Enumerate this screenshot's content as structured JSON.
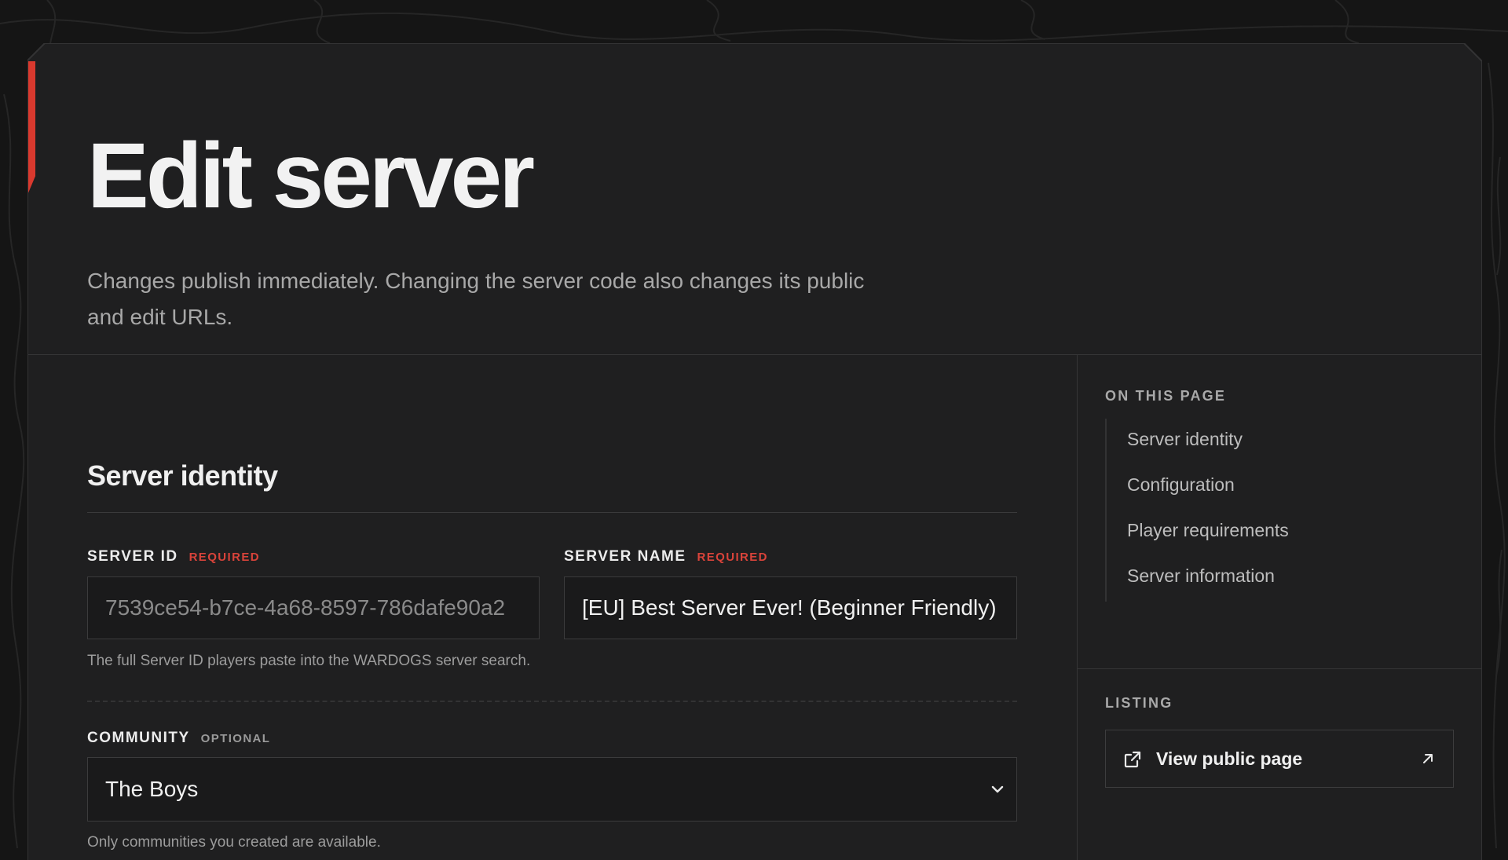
{
  "header": {
    "title": "Edit server",
    "description": "Changes publish immediately. Changing the server code also changes its public and edit URLs."
  },
  "identity": {
    "section_title": "Server identity",
    "server_id": {
      "label": "SERVER ID",
      "tag": "REQUIRED",
      "value": "7539ce54-b7ce-4a68-8597-786dafe90a2",
      "hint": "The full Server ID players paste into the WARDOGS server search."
    },
    "server_name": {
      "label": "SERVER NAME",
      "tag": "REQUIRED",
      "value": "[EU] Best Server Ever! (Beginner Friendly)"
    },
    "community": {
      "label": "COMMUNITY",
      "tag": "OPTIONAL",
      "selected": "The Boys",
      "hint": "Only communities you created are available."
    }
  },
  "sidebar": {
    "on_this_page_heading": "ON THIS PAGE",
    "toc": [
      {
        "label": "Server identity"
      },
      {
        "label": "Configuration"
      },
      {
        "label": "Player requirements"
      },
      {
        "label": "Server information"
      }
    ],
    "listing_heading": "LISTING",
    "view_public_label": "View public page"
  },
  "icons": {
    "external": "external-link-icon",
    "arrow": "arrow-up-right-icon",
    "chevron": "chevron-down-icon"
  },
  "colors": {
    "accent": "#d9392e",
    "required": "#d9433a",
    "background": "#151515",
    "panel": "#1f1f20"
  }
}
